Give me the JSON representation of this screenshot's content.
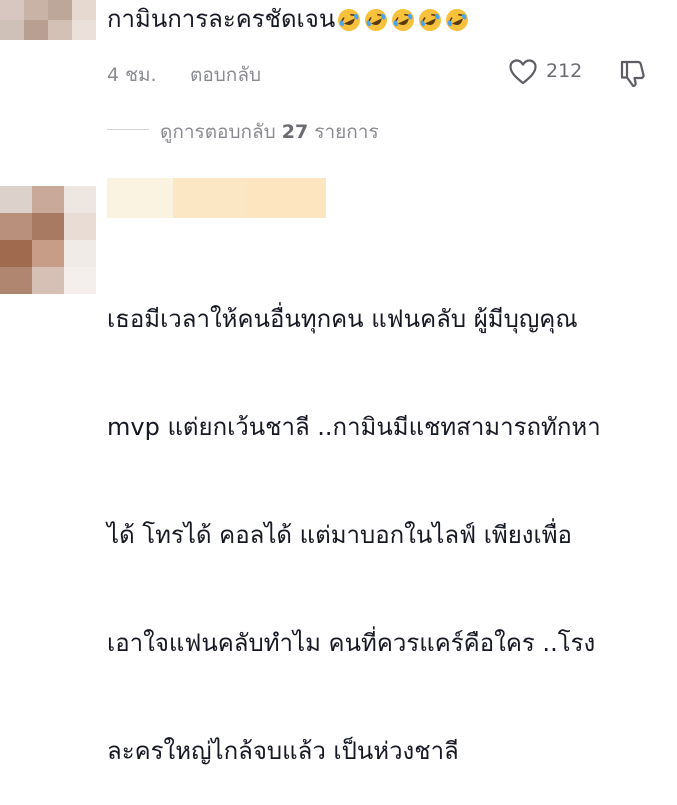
{
  "comment1": {
    "text": "กามินการละครชัดเจน",
    "emoji_names": [
      "rolling-on-floor-laughing",
      "rolling-on-floor-laughing",
      "rolling-on-floor-laughing",
      "rolling-on-floor-laughing",
      "rolling-on-floor-laughing"
    ],
    "time": "4 ชม.",
    "reply_label": "ตอบกลับ",
    "like_count": "212",
    "like_icon": "heart-outline-icon",
    "dislike_icon": "thumbs-down-outline-icon"
  },
  "replies": {
    "prefix": "ดูการตอบกลับ",
    "count": "27",
    "suffix": "รายการ"
  },
  "comment2": {
    "lines": [
      "เธอมีเวลาให้คนอื่นทุกคน แฟนคลับ ผู้มีบุญคุณ",
      "mvp แต่ยกเว้นชาลี ..กามินมีแชทสามารถทักหา",
      "ได้ โทรได้ คอลได้ แต่มาบอกในไลฟ์ เพียงเพื่อ",
      "เอาใจแฟนคลับทำไม คนที่ควรแคร์คือใคร ..โรง",
      "ละครใหญ่ไกล้จบแล้ว เป็นห่วงชาลี"
    ]
  },
  "colors": {
    "text_primary": "#161823",
    "text_secondary": "#8a8b91",
    "divider": "#d2d3d6",
    "emoji_face": "#f7c13b",
    "emoji_tear": "#4aa3f0"
  }
}
